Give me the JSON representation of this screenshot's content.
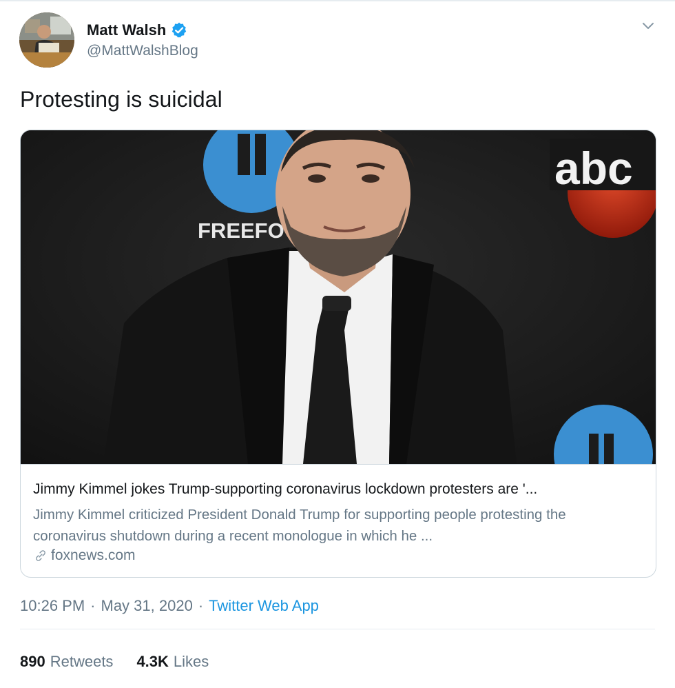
{
  "author": {
    "name": "Matt Walsh",
    "handle": "@MattWalshBlog",
    "verified": true
  },
  "tweet": {
    "text": "Protesting is suicidal"
  },
  "card": {
    "title": "Jimmy Kimmel jokes Trump-supporting coronavirus lockdown protesters are '...",
    "description": "Jimmy Kimmel criticized President Donald Trump for supporting people protesting the coronavirus shutdown during a recent monologue in which he ...",
    "domain": "foxnews.com",
    "image_texts": {
      "backdrop_text": "FREEFO",
      "logo_text": "abc"
    }
  },
  "meta": {
    "time": "10:26 PM",
    "separator": "·",
    "date": "May 31, 2020",
    "source": "Twitter Web App"
  },
  "stats": {
    "retweets_count": "890",
    "retweets_label": "Retweets",
    "likes_count": "4.3K",
    "likes_label": "Likes"
  },
  "colors": {
    "link_blue": "#1b95e0",
    "secondary_text": "#657786",
    "primary_text": "#14171a",
    "verified_blue": "#1da1f2",
    "border": "#ccd6dd"
  },
  "icons": {
    "verified": "verified-badge-icon",
    "caret": "chevron-down-icon",
    "link": "link-icon"
  }
}
